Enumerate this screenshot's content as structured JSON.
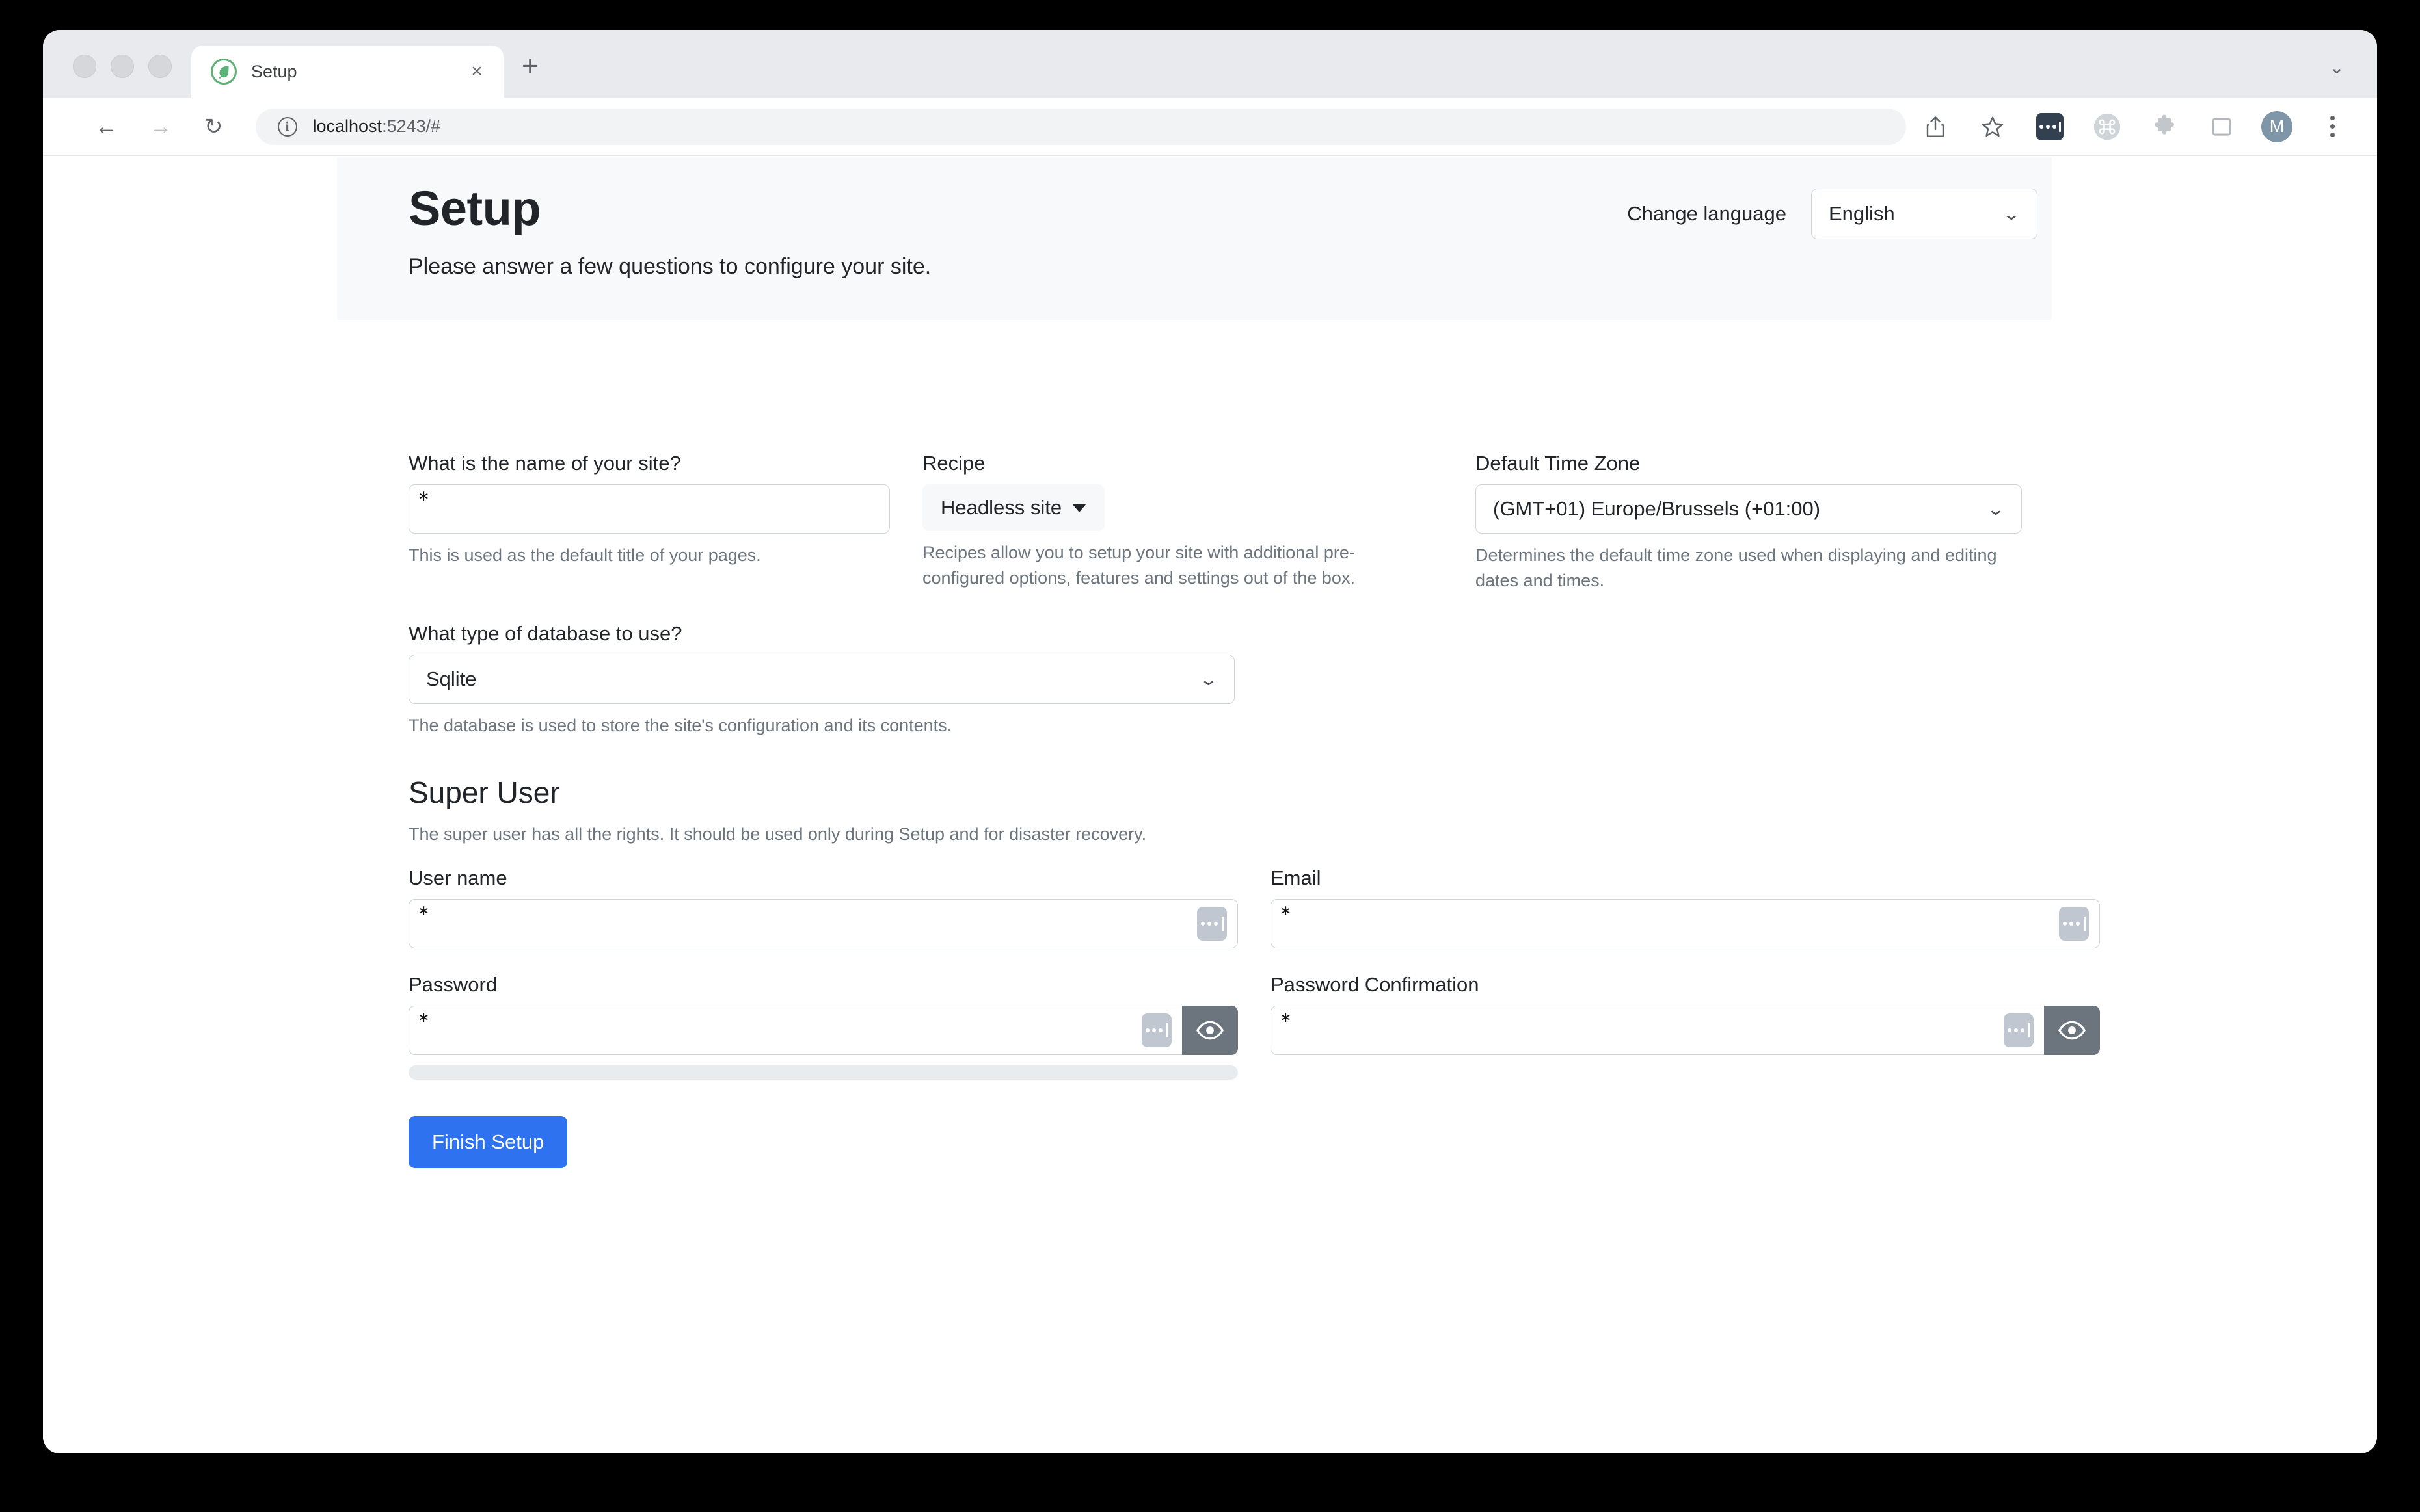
{
  "browser": {
    "tab": {
      "title": "Setup",
      "favicon": "leaf-icon",
      "close": "×"
    },
    "new_tab": "+",
    "tab_list_chevron": "⌄",
    "nav": {
      "back": "←",
      "forward": "→",
      "reload": "↻"
    },
    "omnibox": {
      "info_icon": "i",
      "url_host": "localhost",
      "url_rest": ":5243/#"
    },
    "toolbar_icons": [
      {
        "name": "share-icon",
        "glyph": "⇧"
      },
      {
        "name": "bookmark-star-icon",
        "glyph": "☆"
      },
      {
        "name": "extension-dots-icon",
        "glyph": "•••"
      },
      {
        "name": "command-icon",
        "glyph": "⌘"
      },
      {
        "name": "puzzle-extension-icon",
        "glyph": "❖"
      },
      {
        "name": "sidebar-panel-icon",
        "glyph": "□"
      }
    ],
    "avatar_initial": "M",
    "menu": "⋮"
  },
  "hero": {
    "title": "Setup",
    "subtitle": "Please answer a few questions to configure your site.",
    "language_label": "Change language",
    "language_value": "English"
  },
  "form": {
    "site_name": {
      "label": "What is the name of your site?",
      "value": "",
      "required_marker": "∗",
      "help": "This is used as the default title of your pages."
    },
    "recipe": {
      "label": "Recipe",
      "value": "Headless site",
      "help": "Recipes allow you to setup your site with additional pre-configured options, features and settings out of the box."
    },
    "timezone": {
      "label": "Default Time Zone",
      "value": "(GMT+01) Europe/Brussels (+01:00)",
      "help": "Determines the default time zone used when displaying and editing dates and times."
    },
    "database": {
      "label": "What type of database to use?",
      "value": "Sqlite",
      "help": "The database is used to store the site's configuration and its contents."
    }
  },
  "super_user": {
    "title": "Super User",
    "description": "The super user has all the rights. It should be used only during Setup and for disaster recovery.",
    "user_name": {
      "label": "User name",
      "value": "",
      "required_marker": "∗"
    },
    "email": {
      "label": "Email",
      "value": "",
      "required_marker": "∗"
    },
    "password": {
      "label": "Password",
      "value": "",
      "required_marker": "∗"
    },
    "password_confirmation": {
      "label": "Password Confirmation",
      "value": "",
      "required_marker": "∗"
    }
  },
  "actions": {
    "submit_label": "Finish Setup"
  },
  "colors": {
    "primary": "#2f72f0",
    "secondary": "#6c757d",
    "hero_bg": "#f8f9fa",
    "border": "#ced4da",
    "muted_text": "#6c757d",
    "badge": "#c1c7d0",
    "brand_green": "#5cb176"
  }
}
